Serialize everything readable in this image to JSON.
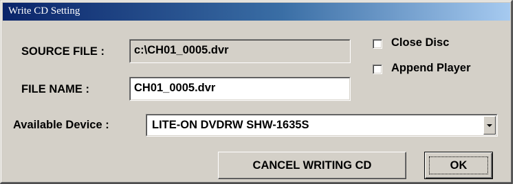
{
  "window": {
    "title": "Write CD Setting"
  },
  "source_file": {
    "label": "SOURCE FILE :",
    "value": "c:\\CH01_0005.dvr"
  },
  "file_name": {
    "label": "FILE NAME :",
    "value": "CH01_0005.dvr"
  },
  "options": {
    "close_disc": {
      "label": "Close Disc",
      "checked": false
    },
    "append_player": {
      "label": "Append Player",
      "checked": false
    }
  },
  "device": {
    "label": "Available Device :",
    "selected": "LITE-ON  DVDRW SHW-1635S"
  },
  "buttons": {
    "cancel_label": "CANCEL WRITING CD",
    "ok_label": "OK"
  },
  "colors": {
    "face": "#d4d0c8",
    "title_start": "#0a246a",
    "title_end": "#a6caf0"
  }
}
